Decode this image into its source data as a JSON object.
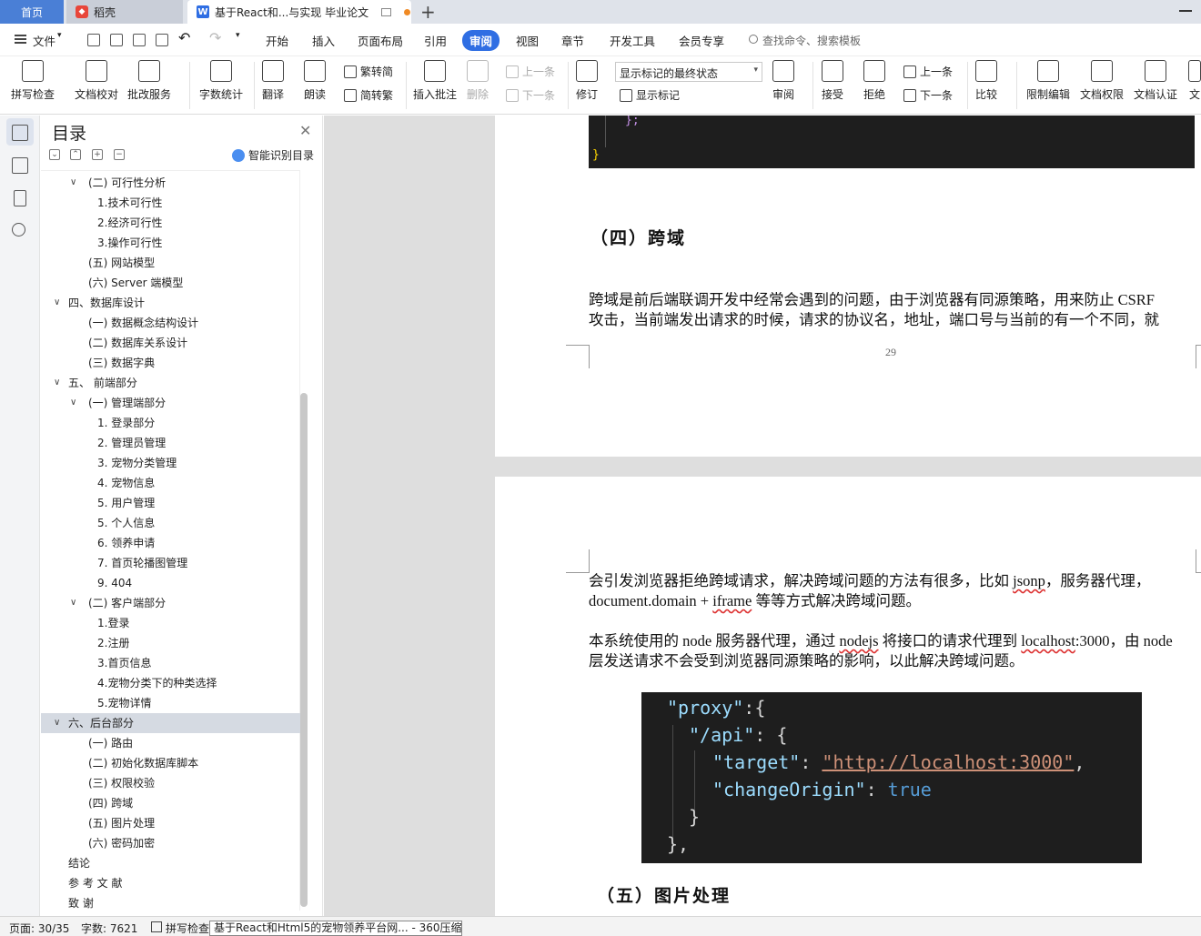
{
  "tabs": {
    "home": "首页",
    "daoke": "稻壳",
    "doc": "基于React和...与实现 毕业论文"
  },
  "menu": {
    "file": "文件",
    "items": [
      "开始",
      "插入",
      "页面布局",
      "引用",
      "审阅",
      "视图",
      "章节",
      "开发工具",
      "会员专享"
    ],
    "active": "审阅",
    "search_placeholder": "查找命令、搜索模板"
  },
  "ribbon": {
    "spell_check": "拼写检查",
    "doc_proof": "文档校对",
    "batch_service": "批改服务",
    "word_count": "字数统计",
    "translate": "翻译",
    "read_aloud": "朗读",
    "trad_convert": "繁转简",
    "simp_convert": "简转繁",
    "insert_comment": "插入批注",
    "delete": "删除",
    "prev_comment": "上一条",
    "next_comment": "下一条",
    "revise": "修订",
    "markup_state": "显示标记的最终状态",
    "show_markup": "显示标记",
    "review": "审阅",
    "accept": "接受",
    "reject": "拒绝",
    "prev_change": "上一条",
    "next_change": "下一条",
    "compare": "比较",
    "restrict_edit": "限制编辑",
    "doc_permission": "文档权限",
    "doc_cert": "文档认证",
    "more": "文"
  },
  "toc": {
    "title": "目录",
    "smart_label": "智能识别目录",
    "items": [
      {
        "label": "(二)  可行性分析",
        "level": 2,
        "chev": true
      },
      {
        "label": "1.技术可行性",
        "level": 3
      },
      {
        "label": "2.经济可行性",
        "level": 3
      },
      {
        "label": "3.操作可行性",
        "level": 3
      },
      {
        "label": "(五)    网站模型",
        "level": 2
      },
      {
        "label": "(六)  Server 端模型",
        "level": 2
      },
      {
        "label": "四、数据库设计",
        "level": 1,
        "chev": true
      },
      {
        "label": "(一)  数据概念结构设计",
        "level": 2
      },
      {
        "label": "(二)  数据库关系设计",
        "level": 2
      },
      {
        "label": "(三)  数据字典",
        "level": 2
      },
      {
        "label": "五、    前端部分",
        "level": 1,
        "chev": true
      },
      {
        "label": "(一)  管理端部分",
        "level": 2,
        "chev": true
      },
      {
        "label": "1.  登录部分",
        "level": 3
      },
      {
        "label": "2.  管理员管理",
        "level": 3
      },
      {
        "label": "3.  宠物分类管理",
        "level": 3
      },
      {
        "label": "4.  宠物信息",
        "level": 3
      },
      {
        "label": "5.  用户管理",
        "level": 3
      },
      {
        "label": "5.  个人信息",
        "level": 3
      },
      {
        "label": "6.  领养申请",
        "level": 3
      },
      {
        "label": "7.  首页轮播图管理",
        "level": 3
      },
      {
        "label": "9. 404",
        "level": 3
      },
      {
        "label": "(二)  客户端部分",
        "level": 2,
        "chev": true
      },
      {
        "label": "1.登录",
        "level": 3
      },
      {
        "label": "2.注册",
        "level": 3
      },
      {
        "label": "3.首页信息",
        "level": 3
      },
      {
        "label": "4.宠物分类下的种类选择",
        "level": 3
      },
      {
        "label": "5.宠物详情",
        "level": 3
      },
      {
        "label": "六、后台部分",
        "level": 1,
        "chev": true,
        "selected": true
      },
      {
        "label": "(一)  路由",
        "level": 2
      },
      {
        "label": "(二)    初始化数据库脚本",
        "level": 2
      },
      {
        "label": "(三)  权限校验",
        "level": 2
      },
      {
        "label": "(四)  跨域",
        "level": 2
      },
      {
        "label": "(五)  图片处理",
        "level": 2
      },
      {
        "label": "(六)  密码加密",
        "level": 2
      },
      {
        "label": "结论",
        "level": 1
      },
      {
        "label": "参 考 文 献",
        "level": 1
      },
      {
        "label": "致    谢",
        "level": 1
      }
    ]
  },
  "doc": {
    "code_top": [
      "}",
      "};",
      "}"
    ],
    "heading4": "（四）跨域",
    "para1_line1": "跨域是前后端联调开发中经常会遇到的问题，由于浏览器有同源策略，用来防止 CSRF",
    "para1_line2": "攻击，当前端发出请求的时候，请求的协议名，地址，端口号与当前的有一个不同，就",
    "page_number": "29",
    "para2_line1a": "会引发浏览器拒绝跨域请求，解决跨域问题的方法有很多，比如 ",
    "para2_jsonp": "jsonp",
    "para2_line1b": "，服务器代理，",
    "para2_line2a": "document.domain + ",
    "para2_iframe": "iframe",
    "para2_line2b": " 等等方式解决跨域问题。",
    "para3_line1a": "本系统使用的 node 服务器代理，通过 ",
    "para3_nodejs": "nodejs",
    "para3_line1b": " 将接口的请求代理到 ",
    "para3_localhost": "localhost",
    "para3_line1c": ":3000，由 node",
    "para3_line2": "层发送请求不会受到浏览器同源策略的影响，以此解决跨域问题。",
    "code": {
      "l1_key": "\"proxy\"",
      "l1_rest": ":{",
      "l2_key": "\"/api\"",
      "l2_rest": ": {",
      "l3_key": "\"target\"",
      "l3_colon": ": ",
      "l3_val": "\"http://localhost:3000\"",
      "l3_comma": ",",
      "l4_key": "\"changeOrigin\"",
      "l4_colon": ": ",
      "l4_val": "true",
      "l5": "}",
      "l6": "},"
    },
    "heading5": "（五）图片处理"
  },
  "status": {
    "page": "页面: 30/35",
    "words": "字数: 7621",
    "spell": "拼写检查",
    "tooltip": "基于React和Html5的宠物领养平台网... - 360压缩"
  },
  "colors": {
    "accent": "#2f6ee3",
    "code_bg": "#1e1e1e"
  }
}
